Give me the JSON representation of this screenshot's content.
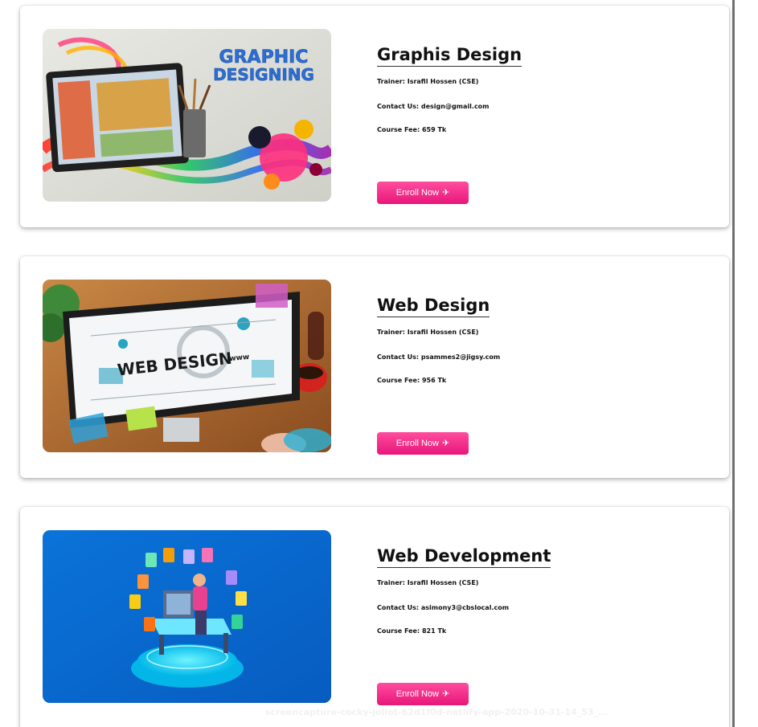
{
  "courses": [
    {
      "title": "Graphis Design",
      "trainer": "Trainer: Israfil Hossen (CSE)",
      "contact": "Contact Us: design@gmail.com",
      "fee": "Course Fee: 659 Tk",
      "enroll_label": "Enroll Now",
      "image_text": [
        "GRAPHIC",
        "DESIGNING"
      ]
    },
    {
      "title": "Web Design",
      "trainer": "Trainer: Israfil Hossen (CSE)",
      "contact": "Contact Us: psammes2@jigsy.com",
      "fee": "Course Fee: 956 Tk",
      "enroll_label": "Enroll Now",
      "image_text": [
        "WEB DESIGN",
        "www"
      ]
    },
    {
      "title": "Web Development",
      "trainer": "Trainer: Israfil Hossen (CSE)",
      "contact": "Contact Us: asimony3@cbslocal.com",
      "fee": "Course Fee: 821 Tk",
      "enroll_label": "Enroll Now",
      "image_text": []
    }
  ],
  "watermark": "screencapture-cocky-joliot-62d1f0d-netlify-app-2020-10-31-14_53_...",
  "colors": {
    "button_gradient_top": "#ff4d9e",
    "button_gradient_bottom": "#e8167a",
    "card_bg": "#ffffff"
  },
  "icons": {
    "enroll_icon": "airplane-icon"
  }
}
